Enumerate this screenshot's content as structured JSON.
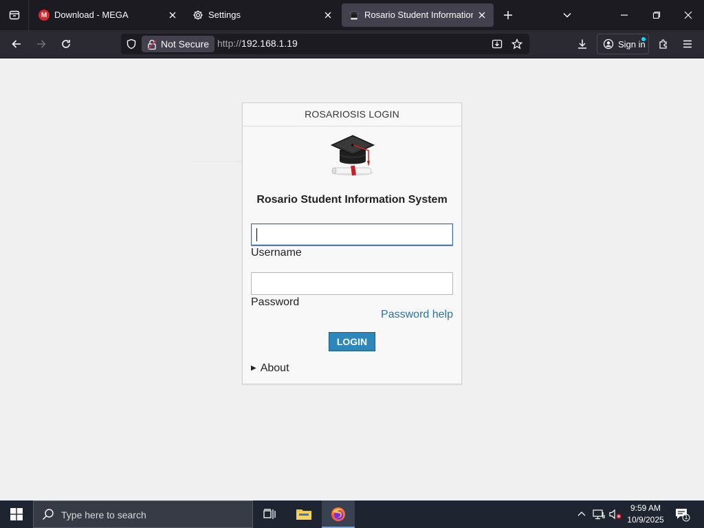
{
  "browser": {
    "tabs": [
      {
        "title": "Download - MEGA",
        "favicon": "mega-logo",
        "active": false
      },
      {
        "title": "Settings",
        "favicon": "gear-icon",
        "active": false
      },
      {
        "title": "Rosario Student Information Sy",
        "favicon": "graduation-cap-icon",
        "active": true
      }
    ],
    "security_label": "Not Secure",
    "url_protocol": "http://",
    "url_host": "192.168.1.19",
    "signin_label": "Sign in"
  },
  "page": {
    "header": "ROSARIOSIS LOGIN",
    "app_title": "Rosario Student Information System",
    "username_label": "Username",
    "username_value": "",
    "password_label": "Password",
    "password_value": "",
    "password_help": "Password help",
    "login_button": "LOGIN",
    "about_label": "About"
  },
  "taskbar": {
    "search_placeholder": "Type here to search",
    "time": "9:59 AM",
    "date": "10/9/2025",
    "notification_count": "1"
  },
  "colors": {
    "tabbar_bg": "#1c1b22",
    "navbar_bg": "#2b2a33",
    "login_button_bg": "#2e87ba",
    "link_color": "#2a72a0",
    "taskbar_bg": "#1f2530"
  }
}
